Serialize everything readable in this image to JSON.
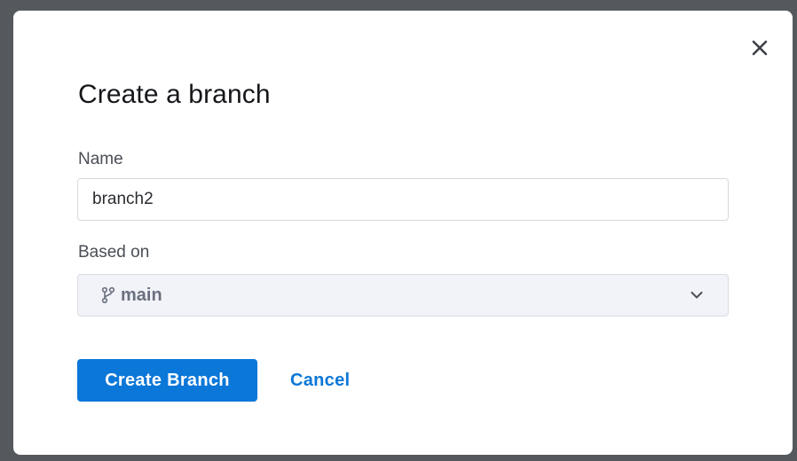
{
  "dialog": {
    "title": "Create a branch",
    "close_icon": "close-icon"
  },
  "form": {
    "name": {
      "label": "Name",
      "value": "branch2"
    },
    "based_on": {
      "label": "Based on",
      "selected": "main",
      "icon": "git-branch-icon"
    }
  },
  "actions": {
    "create_label": "Create Branch",
    "cancel_label": "Cancel"
  },
  "colors": {
    "primary": "#0b77d8",
    "overlay": "#55585c",
    "select_bg": "#f2f3f8"
  }
}
